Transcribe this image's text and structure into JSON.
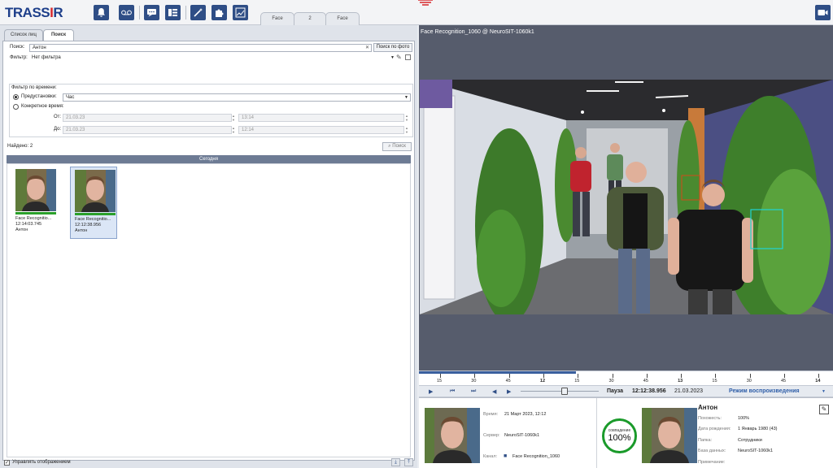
{
  "app": {
    "logo": "TRASSIR",
    "camera_tabs": [
      "Face",
      "2",
      "Face"
    ]
  },
  "toolbar": {
    "icons": [
      "bell-icon",
      "tape-icon",
      "chat-icon",
      "list-icon",
      "magic-wand-icon",
      "puzzle-icon",
      "chart-edit-icon"
    ]
  },
  "left_panel": {
    "tabs": [
      "Список лиц",
      "Поиск"
    ],
    "active_tab": "Поиск",
    "search": {
      "label": "Поиск:",
      "value": "Антон",
      "photo_button": "Поиск по фото"
    },
    "filter": {
      "label": "Фильтр:",
      "value": "Нет фильтра"
    },
    "time_filter": {
      "title": "Фильтр по времени:",
      "preset_label": "Предустановки:",
      "preset_value": "Час",
      "specific_label": "Конкретное время:",
      "from_label": "От:",
      "from_date": "21.03.23",
      "from_time": "13:14",
      "to_label": "До:",
      "to_date": "21.03.23",
      "to_time": "12:14"
    },
    "found": "Найдено: 2",
    "search_button": "Поиск",
    "results_header": "Сегодня",
    "results": [
      {
        "name": "Face Recognitio...",
        "time": "12:14:03.745",
        "person": "Антон",
        "selected": false
      },
      {
        "name": "Face Recognitio...",
        "time": "12:12:38.956",
        "person": "Антон",
        "selected": true
      }
    ],
    "manage_display": "Управлять отображением"
  },
  "video": {
    "title": "Face Recognition_1060 @ NeuroSIT-1060k1",
    "timeline_ticks": [
      "15",
      "30",
      "45",
      "12",
      "15",
      "30",
      "45",
      "13",
      "15",
      "30",
      "45",
      "14"
    ],
    "timeline_progress": 0.38,
    "status": "Пауза",
    "time": "12:12:38.956",
    "date": "21.03.2023",
    "mode": "Режим воспроизведения"
  },
  "info": {
    "event": {
      "time_label": "Время:",
      "time_value": "21 Март 2023, 12:12",
      "server_label": "Сервер:",
      "server_value": "NeuroSIT-1060k1",
      "channel_label": "Канал:",
      "channel_value": "Face Recognition_1060"
    },
    "match": {
      "label": "совпадение",
      "percent": "100%"
    },
    "person": {
      "name": "Антон",
      "similarity_label": "Похожесть:",
      "similarity_value": "100%",
      "birth_label": "Дата рождения:",
      "birth_value": "1 Январь 1980 (43)",
      "folder_label": "Папка:",
      "folder_value": "Сотрудники",
      "db_label": "База данных:",
      "db_value": "NeuroSIT-1060k1",
      "note_label": "Примечание:"
    }
  },
  "colors": {
    "brand_blue": "#1e3f8a",
    "brand_red": "#d7262b",
    "match_green": "#1a9a2a",
    "tracking_cyan": "#1fd4d4"
  }
}
